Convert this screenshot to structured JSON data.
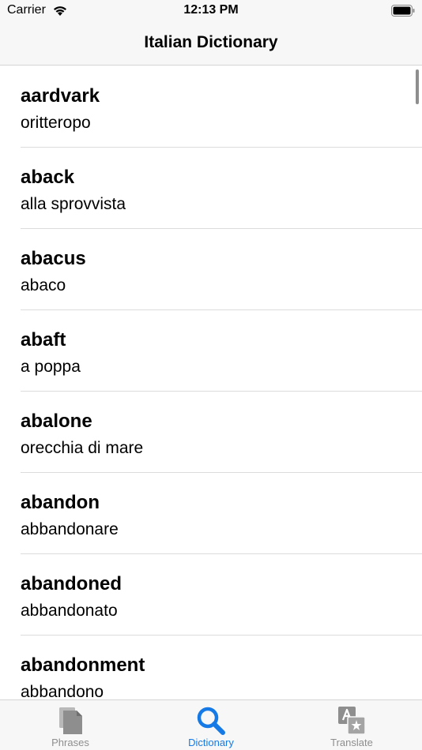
{
  "status_bar": {
    "carrier": "Carrier",
    "time": "12:13 PM"
  },
  "nav": {
    "title": "Italian Dictionary"
  },
  "entries": [
    {
      "word": "aardvark",
      "translation": "oritteropo"
    },
    {
      "word": "aback",
      "translation": "alla sprovvista"
    },
    {
      "word": "abacus",
      "translation": "abaco"
    },
    {
      "word": "abaft",
      "translation": "a poppa"
    },
    {
      "word": "abalone",
      "translation": "orecchia di mare"
    },
    {
      "word": "abandon",
      "translation": "abbandonare"
    },
    {
      "word": "abandoned",
      "translation": "abbandonato"
    },
    {
      "word": "abandonment",
      "translation": "abbandono"
    }
  ],
  "tabs": [
    {
      "label": "Phrases",
      "icon": "document-icon",
      "active": false
    },
    {
      "label": "Dictionary",
      "icon": "search-icon",
      "active": true
    },
    {
      "label": "Translate",
      "icon": "translate-icon",
      "active": false
    }
  ],
  "colors": {
    "accent": "#1579e6",
    "inactive": "#8e8e8e",
    "bar_background": "#f7f7f7"
  }
}
